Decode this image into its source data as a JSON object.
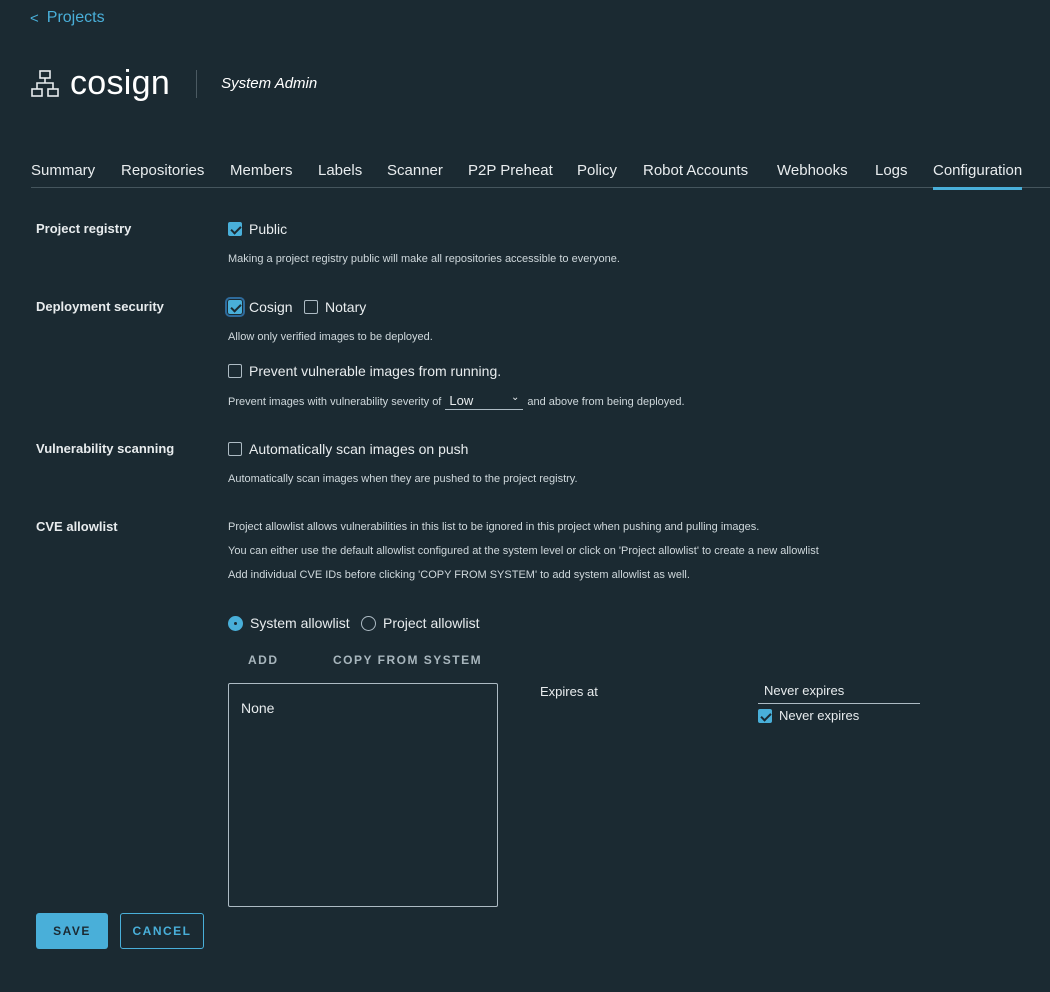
{
  "nav": {
    "back_label": "Projects"
  },
  "project": {
    "name": "cosign",
    "role": "System Admin"
  },
  "tabs": [
    {
      "label": "Summary"
    },
    {
      "label": "Repositories"
    },
    {
      "label": "Members"
    },
    {
      "label": "Labels"
    },
    {
      "label": "Scanner"
    },
    {
      "label": "P2P Preheat"
    },
    {
      "label": "Policy"
    },
    {
      "label": "Robot Accounts"
    },
    {
      "label": "Webhooks"
    },
    {
      "label": "Logs"
    },
    {
      "label": "Configuration"
    }
  ],
  "active_tab": "Configuration",
  "project_registry": {
    "label": "Project registry",
    "public_label": "Public",
    "public_checked": true,
    "help": "Making a project registry public will make all repositories accessible to everyone."
  },
  "deployment_security": {
    "label": "Deployment security",
    "cosign_label": "Cosign",
    "cosign_checked": true,
    "notary_label": "Notary",
    "notary_checked": false,
    "help": "Allow only verified images to be deployed.",
    "prevent_label": "Prevent vulnerable images from running.",
    "prevent_checked": false,
    "severity_prefix": "Prevent images with vulnerability severity of",
    "severity_value": "Low",
    "severity_suffix": "and above from being deployed."
  },
  "vulnerability_scanning": {
    "label": "Vulnerability scanning",
    "auto_scan_label": "Automatically scan images on push",
    "auto_scan_checked": false,
    "help": "Automatically scan images when they are pushed to the project registry."
  },
  "cve_allowlist": {
    "label": "CVE allowlist",
    "desc1": "Project allowlist allows vulnerabilities in this list to be ignored in this project when pushing and pulling images.",
    "desc2": "You can either use the default allowlist configured at the system level or click on 'Project allowlist' to create a new allowlist",
    "desc3": "Add individual CVE IDs before clicking 'COPY FROM SYSTEM' to add system allowlist as well.",
    "system_label": "System allowlist",
    "project_label": "Project allowlist",
    "selected": "System allowlist",
    "add_label": "ADD",
    "copy_label": "COPY FROM SYSTEM",
    "list_empty": "None",
    "expires_label": "Expires at",
    "expires_value": "Never expires",
    "never_expires_label": "Never expires",
    "never_expires_checked": true
  },
  "actions": {
    "save_label": "SAVE",
    "cancel_label": "CANCEL"
  },
  "colors": {
    "accent": "#49afd9",
    "background": "#1b2a32"
  }
}
